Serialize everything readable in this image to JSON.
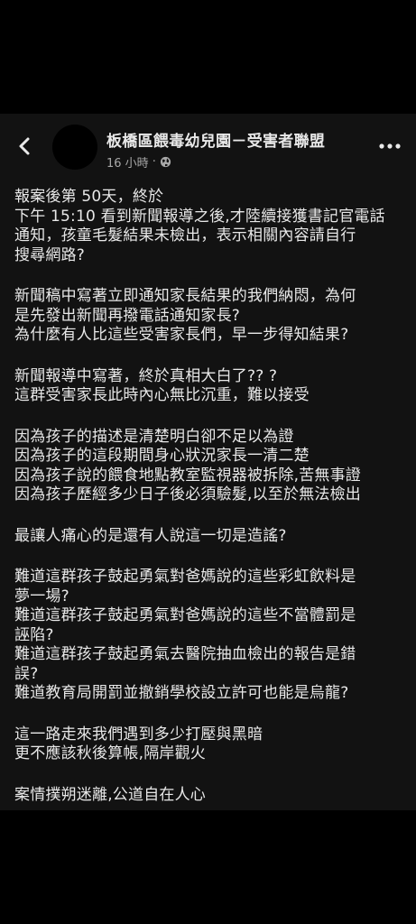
{
  "post": {
    "page_name": "板橋區餵毒幼兒園－受害者聯盟",
    "time": "16 小時",
    "separator": "·",
    "privacy_icon": "globe-icon",
    "back_icon": "chevron-left-icon",
    "more_icon": "more-dots-icon",
    "paragraphs": [
      [
        "報案後第 50天，終於",
        "下午 15:10 看到新聞報導之後,才陸續接獲書記官電話",
        "通知，孩童毛髮結果未檢出，表示相關內容請自行",
        "搜尋網路?"
      ],
      [
        "新聞稿中寫著立即通知家長結果的我們納悶，為何",
        "是先發出新聞再撥電話通知家長?",
        "為什麼有人比這些受害家長們，早一步得知結果?"
      ],
      [
        "新聞報導中寫著，終於真相大白了?? ?",
        "這群受害家長此時內心無比沉重，難以接受"
      ],
      [
        "因為孩子的描述是清楚明白卻不足以為證",
        "因為孩子的這段期間身心狀況家長一清二楚",
        "因為孩子說的餵食地點教室監視器被拆除,苦無事證",
        "因為孩子歷經多少日子後必須驗髮,以至於無法檢出"
      ],
      [
        "最讓人痛心的是還有人說這一切是造謠?"
      ],
      [
        "難道這群孩子鼓起勇氣對爸媽說的這些彩虹飲料是",
        "夢一場?",
        "難道這群孩子鼓起勇氣對爸媽說的這些不當體罰是",
        "誣陷?",
        "難道這群孩子鼓起勇氣去醫院抽血檢出的報告是錯",
        "誤?",
        "難道教育局開罰並撤銷學校設立許可也能是烏龍?"
      ],
      [
        "這一路走來我們遇到多少打壓與黑暗",
        "更不應該秋後算帳,隔岸觀火"
      ],
      [
        "案情撲朔迷離,公道自在人心"
      ]
    ]
  }
}
